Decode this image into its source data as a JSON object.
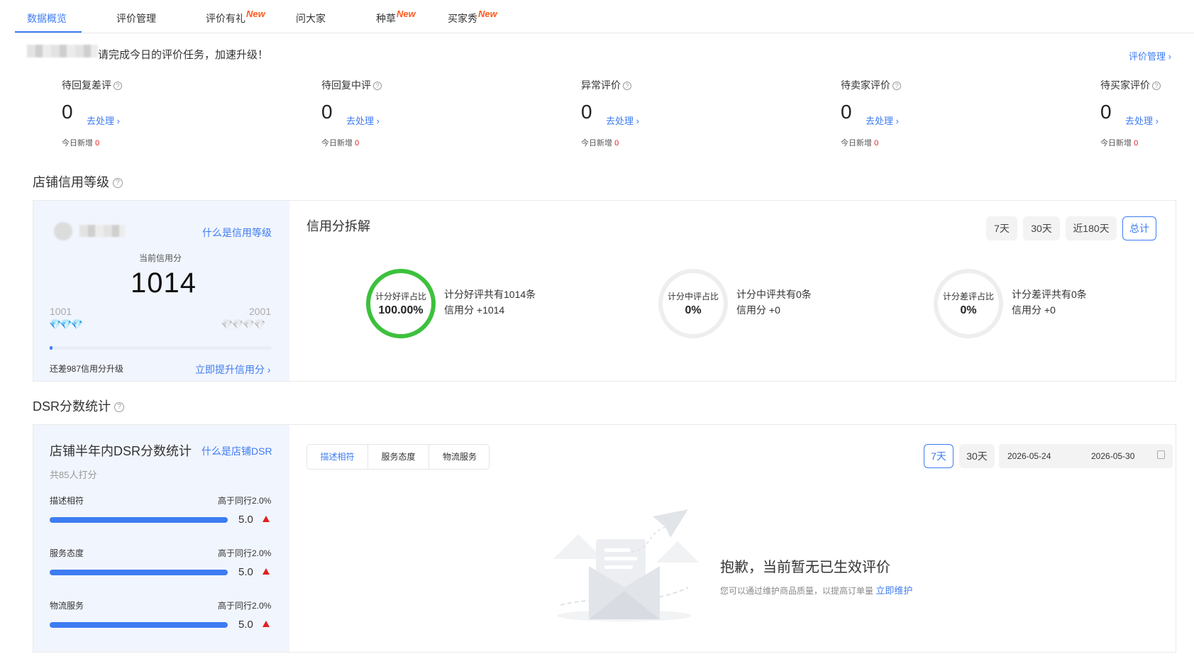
{
  "nav": {
    "tabs": [
      {
        "label": "数据概览",
        "new": ""
      },
      {
        "label": "评价管理",
        "new": ""
      },
      {
        "label": "评价有礼",
        "new": "New"
      },
      {
        "label": "问大家",
        "new": ""
      },
      {
        "label": "种草",
        "new": "New"
      },
      {
        "label": "买家秀",
        "new": "New"
      }
    ]
  },
  "greeting": {
    "text": "请完成今日的评价任务，加速升级！",
    "manage_link": "评价管理 ›"
  },
  "stats": [
    {
      "title": "待回复差评",
      "value": "0",
      "link": "去处理 ›",
      "sub_label": "今日新增",
      "sub_value": "0"
    },
    {
      "title": "待回复中评",
      "value": "0",
      "link": "去处理 ›",
      "sub_label": "今日新增",
      "sub_value": "0"
    },
    {
      "title": "异常评价",
      "value": "0",
      "link": "去处理 ›",
      "sub_label": "今日新增",
      "sub_value": "0"
    },
    {
      "title": "待卖家评价",
      "value": "0",
      "link": "去处理 ›",
      "sub_label": "今日新增",
      "sub_value": "0"
    },
    {
      "title": "待买家评价",
      "value": "0",
      "link": "去处理 ›",
      "sub_label": "今日新增",
      "sub_value": "0"
    }
  ],
  "credit": {
    "section_title": "店铺信用等级",
    "what_link": "什么是信用等级",
    "score_label": "当前信用分",
    "score": "1014",
    "level_min": "1001",
    "level_max": "2001",
    "progress_fraction": 0.013,
    "gap_text": "还差987信用分升级",
    "boost_link": "立即提升信用分 ›",
    "breakdown_title": "信用分拆解",
    "ranges": [
      "7天",
      "30天",
      "近180天",
      "总计"
    ],
    "active_range": "总计",
    "rings": [
      {
        "label": "计分好评占比",
        "value": "100.00%",
        "fill": 1.0,
        "color": "#3cc13c",
        "line1": "计分好评共有1014条",
        "line2": "信用分 +1014"
      },
      {
        "label": "计分中评占比",
        "value": "0%",
        "fill": 0,
        "color": "#eeeeee",
        "line1": "计分中评共有0条",
        "line2": "信用分 +0"
      },
      {
        "label": "计分差评占比",
        "value": "0%",
        "fill": 0,
        "color": "#eeeeee",
        "line1": "计分差评共有0条",
        "line2": "信用分 +0"
      }
    ]
  },
  "dsr": {
    "section_title": "DSR分数统计",
    "panel_title": "店铺半年内DSR分数统计",
    "what_link": "什么是店铺DSR",
    "raters": "共85人打分",
    "items": [
      {
        "name": "描述相符",
        "compare": "高于同行2.0%",
        "score": "5.0",
        "fill": 1.0
      },
      {
        "name": "服务态度",
        "compare": "高于同行2.0%",
        "score": "5.0",
        "fill": 1.0
      },
      {
        "name": "物流服务",
        "compare": "高于同行2.0%",
        "score": "5.0",
        "fill": 1.0
      }
    ],
    "tabs": [
      "描述相符",
      "服务态度",
      "物流服务"
    ],
    "active_tab": "描述相符",
    "ranges": [
      "7天",
      "30天"
    ],
    "active_range": "7天",
    "date_start": "2026-05-24",
    "date_end": "2026-05-30",
    "empty_title": "抱歉，当前暂无已生效评价",
    "empty_desc": "您可以通过维护商品质量，以提高订单量",
    "empty_link": "立即维护"
  }
}
